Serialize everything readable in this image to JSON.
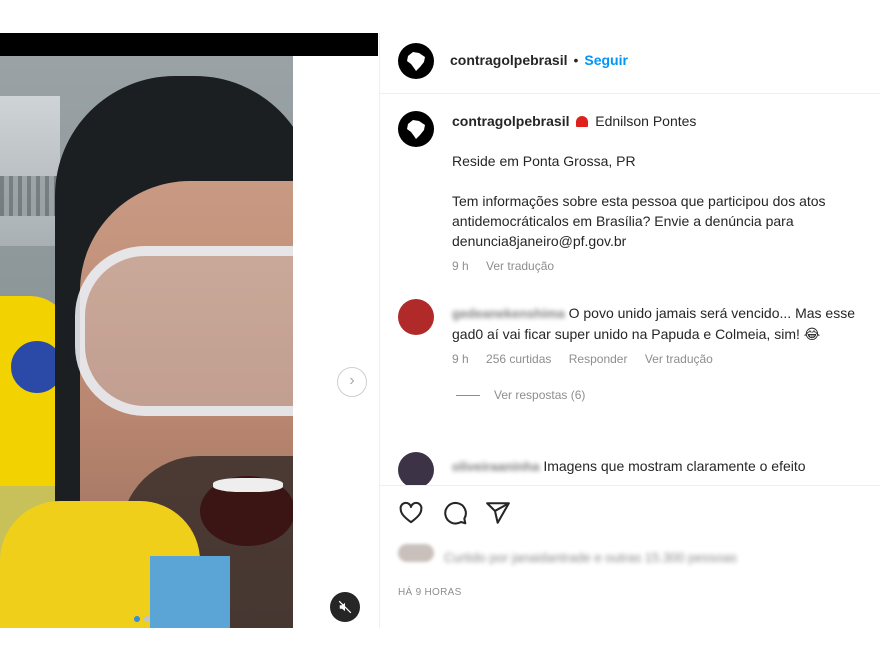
{
  "post": {
    "author": "contragolpebrasil",
    "follow_label": "Seguir",
    "bullet": "•"
  },
  "caption": {
    "author": "contragolpebrasil",
    "badge_icon": "siren-emoji",
    "mentioned": "Ednilson Pontes",
    "line1": "Reside em Ponta Grossa, PR",
    "line2": "Tem informações sobre esta pessoa que participou dos atos antidemocráticalos em Brasília? Envie a denúncia para denuncia8janeiro@pf.gov.br",
    "time": "9 h",
    "translate": "Ver tradução"
  },
  "comments": [
    {
      "user": "gedeanekenshima",
      "text": "O povo unido jamais será vencido... Mas esse gad0 aí vai ficar super unido na Papuda e Colmeia, sim! 😂",
      "time": "9 h",
      "likes": "256 curtidas",
      "reply": "Responder",
      "translate": "Ver tradução",
      "view_replies": "Ver respostas (6)"
    },
    {
      "user": "oliveiraaninha",
      "text": "Imagens que mostram claramente o efeito"
    }
  ],
  "actions": {
    "like_icon": "heart-icon",
    "comment_icon": "comment-icon",
    "share_icon": "share-icon"
  },
  "likes_text": "Curtido por janaidantrade e outras 15.300 pessoas",
  "time_ago": "HÁ 9 HORAS",
  "carousel": {
    "slides": 2,
    "current": 1
  },
  "colors": {
    "accent": "#0095f6",
    "muted": "#8e8e8e",
    "text": "#262626"
  }
}
